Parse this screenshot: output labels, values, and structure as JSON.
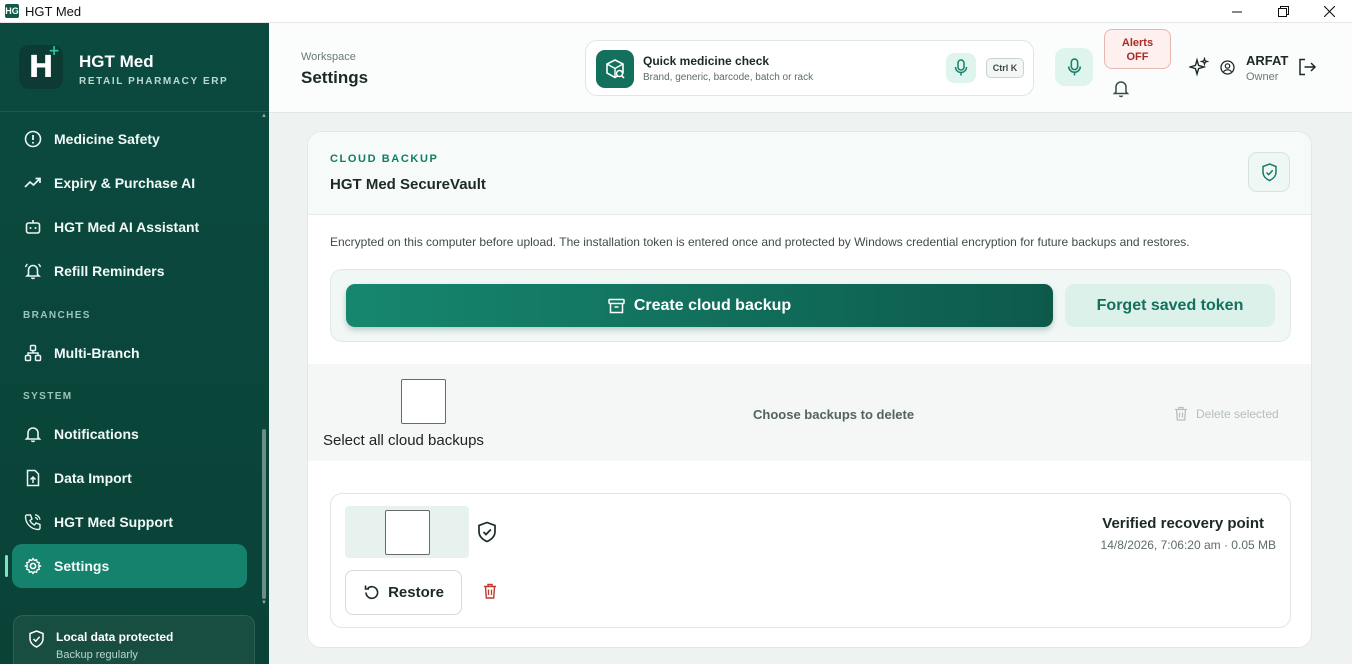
{
  "window": {
    "title": "HGT Med",
    "icon_text": "HG"
  },
  "brand": {
    "name": "HGT Med",
    "subtitle": "RETAIL PHARMACY ERP",
    "logo_letter": "H",
    "logo_plus": "+"
  },
  "sidebar": {
    "items": [
      {
        "label": "Medicine Safety",
        "icon": "alert-circle-icon"
      },
      {
        "label": "Expiry & Purchase AI",
        "icon": "trending-up-icon"
      },
      {
        "label": "HGT Med AI Assistant",
        "icon": "bot-icon"
      },
      {
        "label": "Refill Reminders",
        "icon": "bell-ring-icon"
      }
    ],
    "section_branches": "BRANCHES",
    "branches_items": [
      {
        "label": "Multi-Branch",
        "icon": "network-icon"
      }
    ],
    "section_system": "SYSTEM",
    "system_items": [
      {
        "label": "Notifications",
        "icon": "bell-icon"
      },
      {
        "label": "Data Import",
        "icon": "file-upload-icon"
      },
      {
        "label": "HGT Med Support",
        "icon": "phone-icon"
      },
      {
        "label": "Settings",
        "icon": "gear-icon",
        "active": true
      }
    ],
    "protect": {
      "title": "Local data protected",
      "subtitle": "Backup regularly"
    }
  },
  "header": {
    "breadcrumb": "Workspace",
    "title": "Settings",
    "quick_check": {
      "title": "Quick medicine check",
      "subtitle": "Brand, generic, barcode, batch or rack",
      "shortcut": "Ctrl K"
    },
    "alerts": {
      "line1": "Alerts",
      "line2": "OFF"
    },
    "user": {
      "name": "ARFAT",
      "role": "Owner"
    }
  },
  "backup": {
    "eyebrow": "CLOUD BACKUP",
    "title": "HGT Med SecureVault",
    "description": "Encrypted on this computer before upload. The installation token is entered once and protected by Windows credential encryption for future backups and restores.",
    "create_label": "Create cloud backup",
    "forget_label": "Forget saved token",
    "select_all_label": "Select all cloud backups",
    "choose_label": "Choose backups to delete",
    "delete_selected_label": "Delete selected",
    "items": [
      {
        "title": "Verified recovery point",
        "meta": "14/8/2026, 7:06:20 am · 0.05 MB",
        "restore_label": "Restore"
      }
    ]
  },
  "colors": {
    "sidebar_bg": "#0b4a3f",
    "accent": "#14826c",
    "danger": "#c0392b"
  }
}
